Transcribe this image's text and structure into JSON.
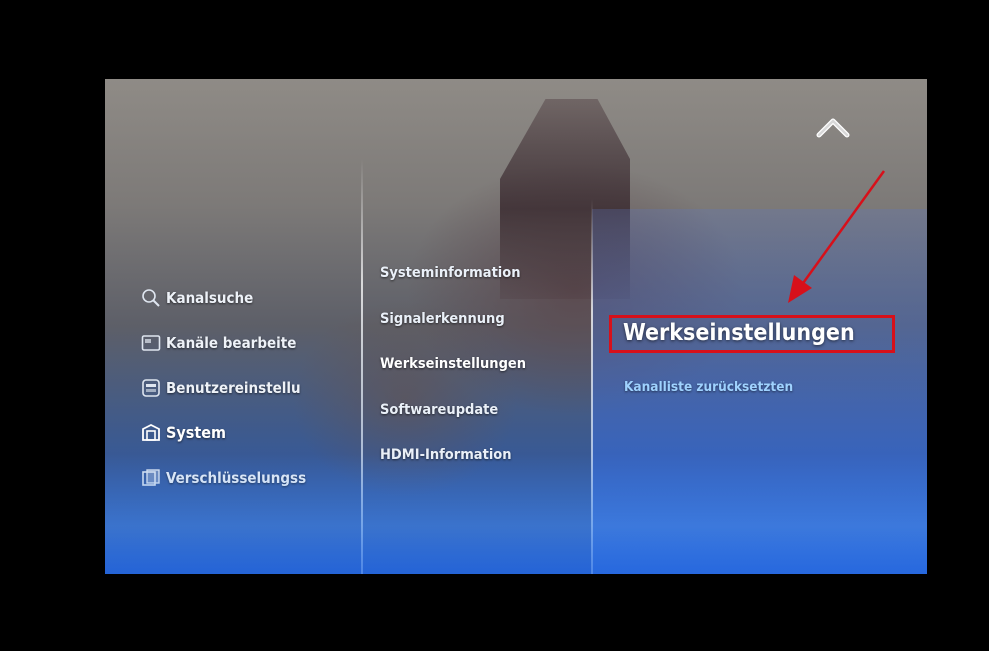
{
  "menu_level1": {
    "items": [
      {
        "label": "Kanalsuche",
        "icon": "search-icon"
      },
      {
        "label": "Kanäle bearbeite",
        "icon": "channel-edit-icon"
      },
      {
        "label": "Benutzereinstellu",
        "icon": "user-settings-icon"
      },
      {
        "label": "System",
        "icon": "system-icon",
        "active": true
      },
      {
        "label": "Verschlüsselungss",
        "icon": "encryption-icon"
      }
    ]
  },
  "menu_level2": {
    "items": [
      {
        "label": "Systeminformation"
      },
      {
        "label": "Signalerkennung"
      },
      {
        "label": "Werkseinstellungen",
        "active": true
      },
      {
        "label": "Softwareupdate"
      },
      {
        "label": "HDMI-Information"
      }
    ]
  },
  "menu_level3": {
    "title": "Werkseinstellungen",
    "items": [
      {
        "label": "Kanalliste zurücksetzten"
      }
    ]
  },
  "colors": {
    "highlight_box": "#d7101a",
    "annotation_arrow": "#d7101a",
    "submenu_text": "#9fd2ff"
  }
}
